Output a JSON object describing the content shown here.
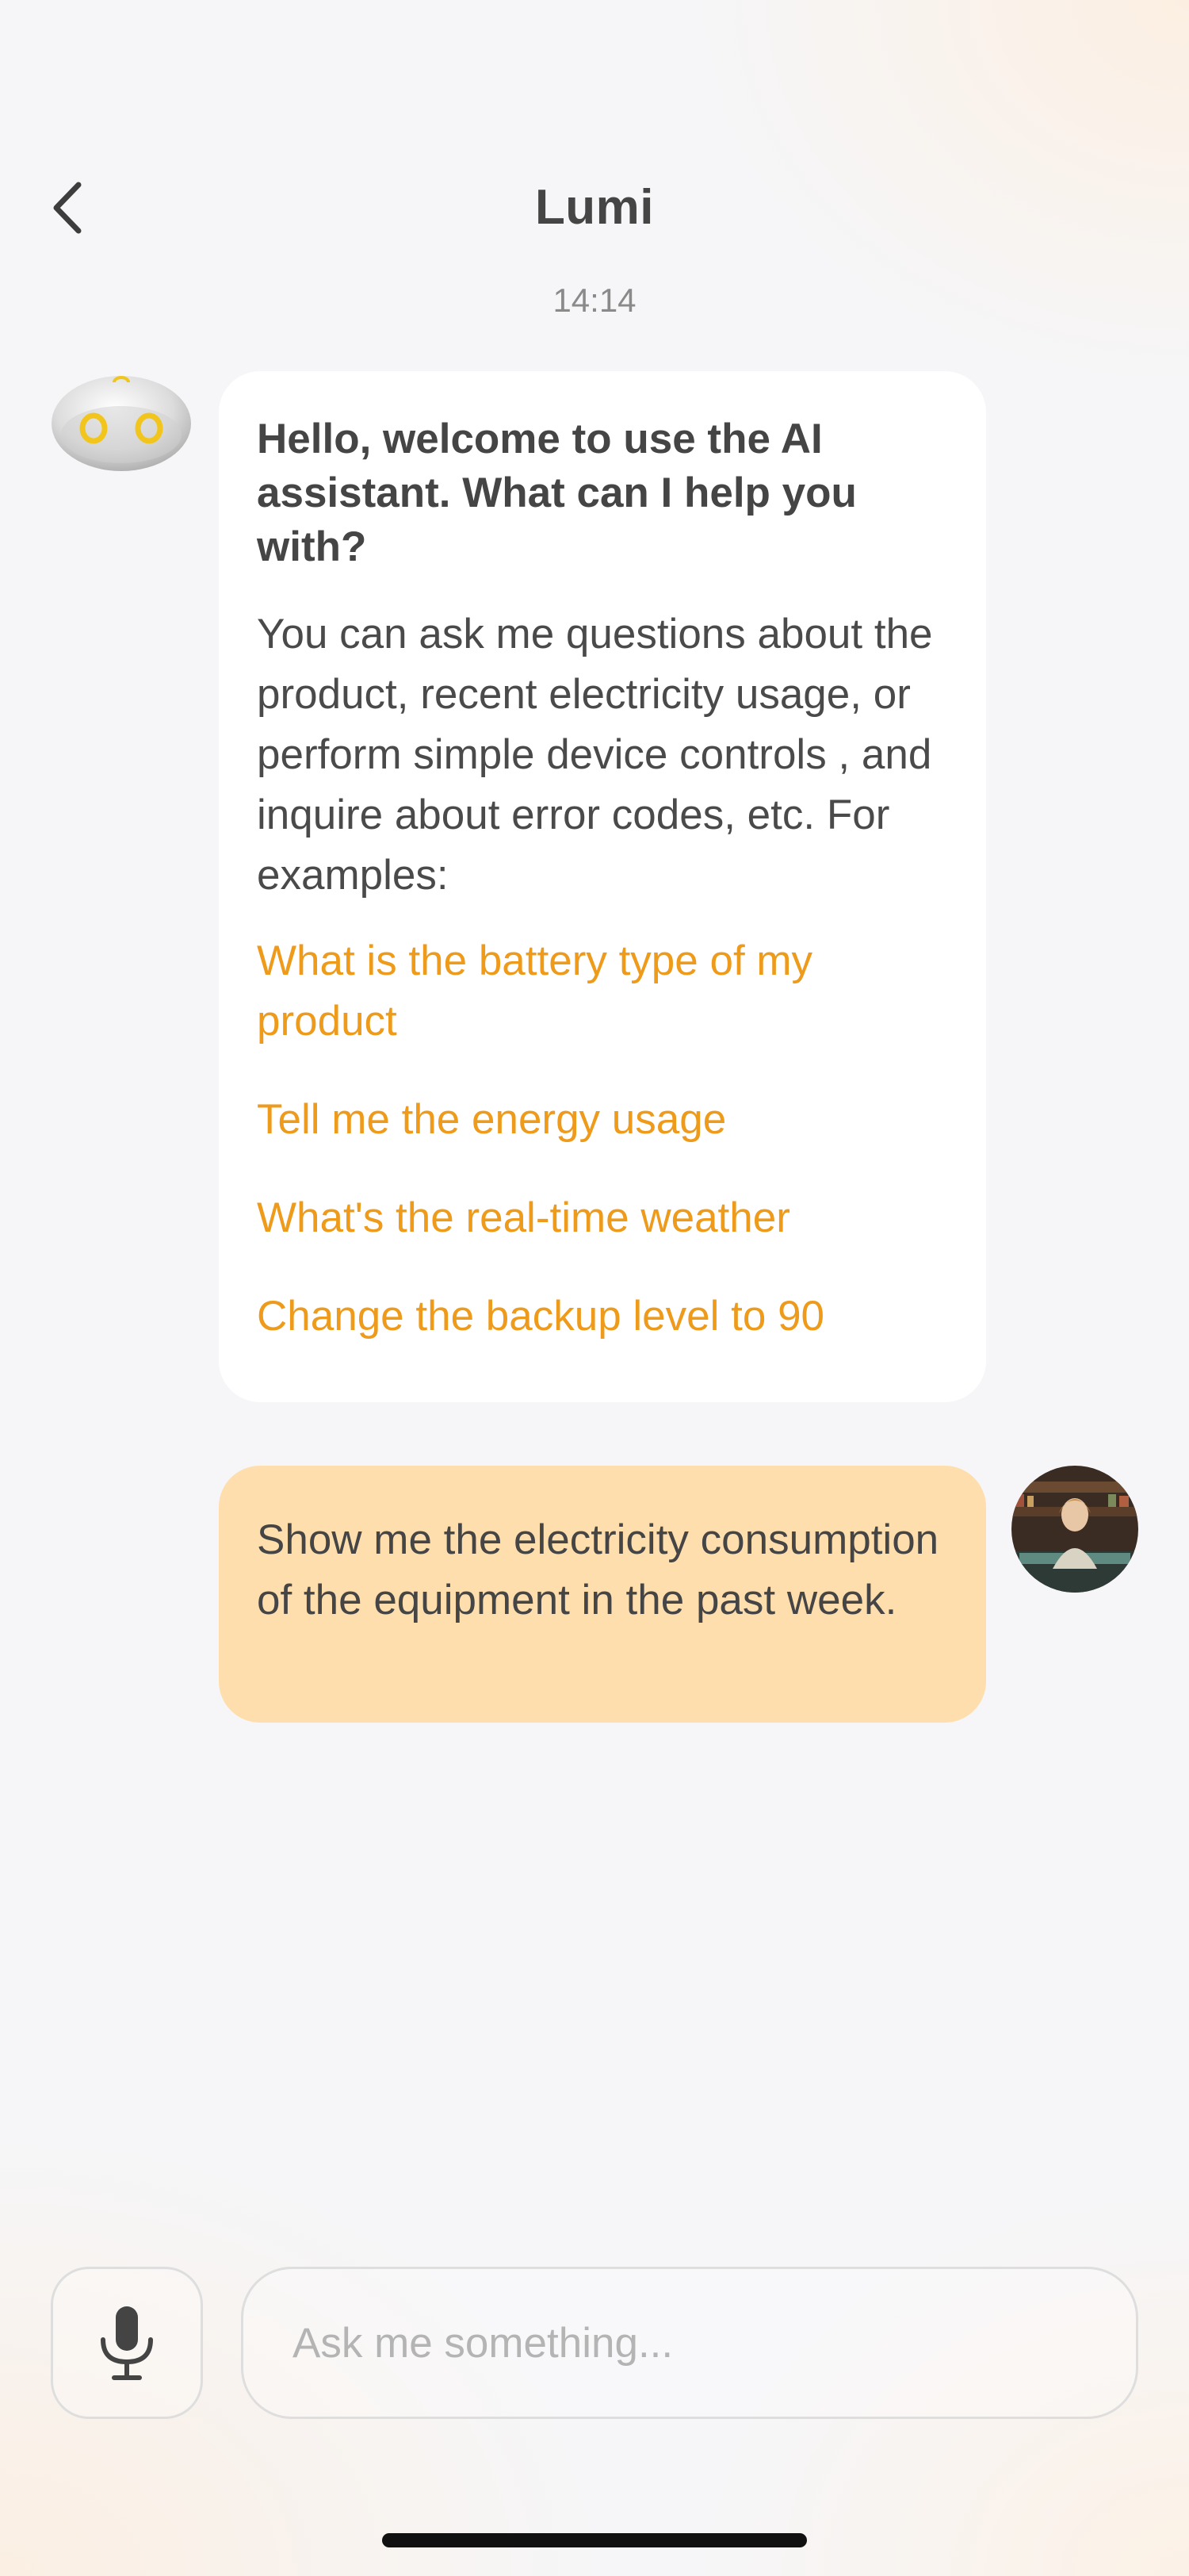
{
  "header": {
    "title": "Lumi",
    "back_icon": "chevron-left-icon"
  },
  "chat": {
    "timestamp": "14:14",
    "bot_message": {
      "heading": "Hello, welcome to use the AI assistant. What can I help you with?",
      "body": "You can ask me questions about the product, recent electricity usage, or perform simple device controls , and inquire about error codes, etc. For examples:",
      "suggestions": [
        "What is the battery type of my product",
        "Tell me the energy usage",
        "What's the real-time weather",
        "Change the backup level to 90"
      ]
    },
    "user_message": {
      "text": "Show me the electricity consumption of the equipment in the past week."
    }
  },
  "composer": {
    "mic_icon": "microphone-icon",
    "placeholder": "Ask me something..."
  },
  "colors": {
    "suggestion": "#ee9a1a",
    "user_bubble": "#ffdeae",
    "bot_bubble": "#ffffff",
    "background": "#f6f6f8"
  }
}
